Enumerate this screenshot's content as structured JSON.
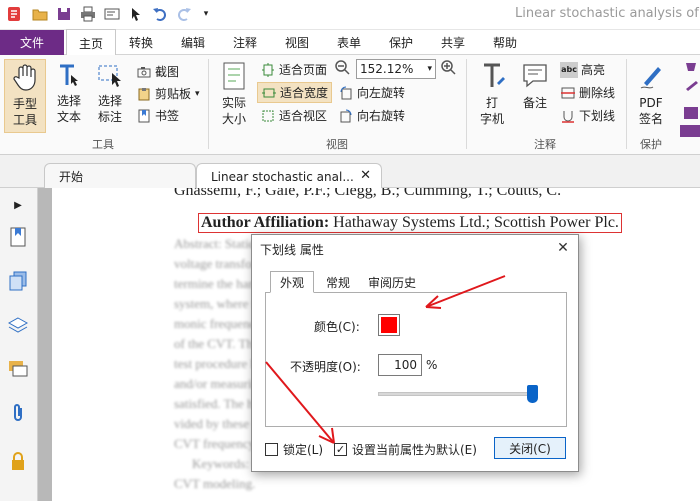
{
  "window": {
    "title": "Linear stochastic analysis of pol"
  },
  "menu": {
    "file": "文件",
    "tabs": [
      "主页",
      "转换",
      "编辑",
      "注释",
      "视图",
      "表单",
      "保护",
      "共享",
      "帮助"
    ]
  },
  "ribbon": {
    "hand_tool": "手型\n工具",
    "select_text": "选择\n文本",
    "select_annot": "选择\n标注",
    "screenshot": "截图",
    "clipboard": "剪贴板",
    "bookmark": "书签",
    "tools_group": "工具",
    "actual_size": "实际\n大小",
    "fit_page": "适合页面",
    "fit_width": "适合宽度",
    "fit_view": "适合视区",
    "zoom": "152.12%",
    "rotate_left": "向左旋转",
    "rotate_right": "向右旋转",
    "view_group": "视图",
    "typewriter": "打\n字机",
    "note": "备注",
    "highlight": "高亮",
    "strikethrough": "删除线",
    "underline": "下划线",
    "annot_group": "注释",
    "pdf_sign": "PDF\n签名",
    "protect_group": "保护"
  },
  "doc_tabs": {
    "start": "开始",
    "doc": "Linear stochastic anal..."
  },
  "document": {
    "line1": "Ghassemi, F.; Gale, P.F.; Clegg, B.; Cumming, T.; Coutts, C.",
    "affil_label": "Author Affiliation:",
    "affil_text": " Hathaway Systems Ltd.; Scottish Power Plc.",
    "blur_lines": [
      "Abstract: Static VAR compensators and their CVT capacitor",
      "voltage transformers have, for many years, been known to de-",
      "termine the harmonic output of the Scottish Power EHV",
      "system, where the harmonic voltage errors at har-",
      "monic frequencies lead to magnetic elements",
      "of the CVT. The analysis of the magnetic states. A",
      "test procedure has been developed for disassembling",
      "and/or measuring accuracy. The measurement is",
      "satisfied. The harmonic response will also be pro-",
      "vided by these parameters which can affect the",
      "CVT frequency characteristics.",
      "Keywords: CVT; Harmonic measurement; Correction,",
      "CVT modeling."
    ]
  },
  "dialog": {
    "title": "下划线 属性",
    "tabs": [
      "外观",
      "常规",
      "审阅历史"
    ],
    "color_label": "颜色(C):",
    "color_value": "#ff0000",
    "opacity_label": "不透明度(O):",
    "opacity_value": "100",
    "opacity_unit": "%",
    "opacity_level": 1.0,
    "lock_label": "锁定(L)",
    "lock_checked": false,
    "default_label": "设置当前属性为默认(E)",
    "default_checked": true,
    "close_label": "关闭(C)"
  },
  "colors": {
    "accent": "#6d2b86",
    "annotation_arrow": "#e0181c"
  }
}
